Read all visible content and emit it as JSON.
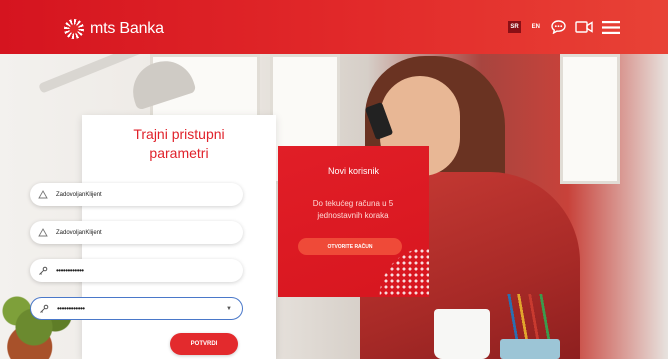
{
  "header": {
    "brand": "mts Banka",
    "languages": [
      {
        "code": "SR",
        "active": true
      },
      {
        "code": "EN",
        "active": false
      }
    ],
    "icons": [
      "chat-icon",
      "video-icon",
      "menu-icon"
    ],
    "accent_color": "#e22a2a"
  },
  "login": {
    "title_line1": "Trajni pristupni",
    "title_line2": "parametri",
    "fields": [
      {
        "value": "ZadovoljanKlijent",
        "icon": "user-icon"
      },
      {
        "value": "ZadovoljanKlijent",
        "icon": "user-icon"
      },
      {
        "value": "••••••••••••",
        "icon": "key-icon"
      },
      {
        "value": "••••••••••••",
        "icon": "key-icon"
      }
    ],
    "submit_label": "POTVRDI"
  },
  "new_user": {
    "title": "Novi korisnik",
    "description": "Do tekućeg računa u 5 jednostavnih koraka",
    "button_label": "OTVORITE RAČUN"
  }
}
